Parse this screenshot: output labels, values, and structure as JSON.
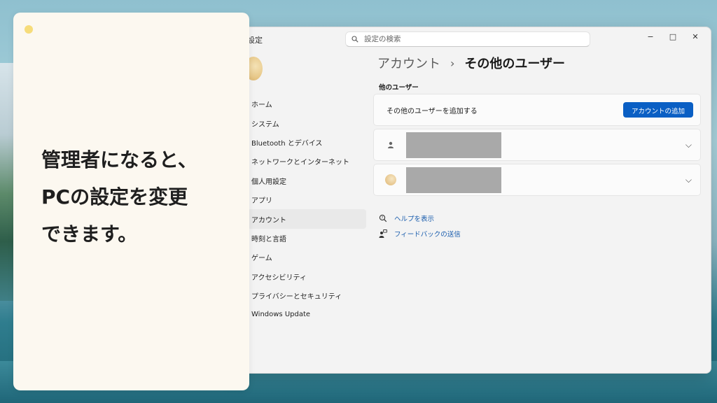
{
  "window": {
    "title": "設定",
    "controls": {
      "minimize": "−",
      "maximize": "□",
      "close": "✕"
    }
  },
  "search": {
    "placeholder": "設定の検索"
  },
  "sidebar": {
    "items": [
      {
        "label": "ホーム"
      },
      {
        "label": "システム"
      },
      {
        "label": "Bluetooth とデバイス"
      },
      {
        "label": "ネットワークとインターネット"
      },
      {
        "label": "個人用設定"
      },
      {
        "label": "アプリ"
      },
      {
        "label": "アカウント",
        "active": true
      },
      {
        "label": "時刻と言語"
      },
      {
        "label": "ゲーム"
      },
      {
        "label": "アクセシビリティ"
      },
      {
        "label": "プライバシーとセキュリティ"
      },
      {
        "label": "Windows Update"
      }
    ]
  },
  "breadcrumb": {
    "parent": "アカウント",
    "separator": "›",
    "current": "その他のユーザー"
  },
  "section": {
    "title": "他のユーザー"
  },
  "add_user": {
    "label": "その他のユーザーを追加する",
    "button": "アカウントの追加"
  },
  "users": [
    {
      "icon": "person-icon"
    },
    {
      "icon": "user-photo-icon"
    }
  ],
  "links": {
    "help": "ヘルプを表示",
    "feedback": "フィードバックの送信"
  },
  "overlay": {
    "lines": [
      "管理者になると、",
      "PCの設定を変更",
      "できます。"
    ]
  },
  "colors": {
    "accent": "#0a5fc4",
    "link": "#1a5dad",
    "overlay_bg": "#fcf8f0",
    "dot": "#f6dc7a"
  }
}
